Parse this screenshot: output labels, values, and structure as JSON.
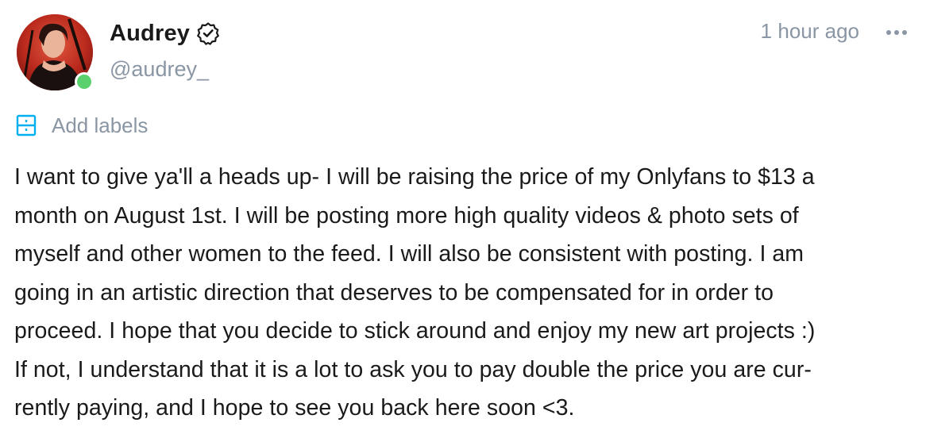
{
  "post": {
    "author": {
      "name": "Audrey",
      "handle": "@audrey_",
      "verified_icon": "verified-badge-icon",
      "online_status_color": "#5ad16c"
    },
    "timestamp": "1 hour ago",
    "more_icon": "more-horizontal-icon",
    "labels": {
      "icon": "label-icon",
      "text": "Add labels"
    },
    "body": "I want to give ya'll a heads up- I will be raising the price of my Onlyfans to $13 a\nmonth on August 1st. I will be posting more high quality videos & photo sets of\nmyself and other women to the feed. I will also be consistent with posting. I am\ngoing in an artistic direction that deserves to be compensated for in order to\nproceed. I hope that you decide to stick around and enjoy my new art projects :)\nIf not, I understand that it is a lot to ask you to pay double the price you are cur-\nrently paying, and I hope to see you back here soon <3."
  },
  "colors": {
    "accent": "#00aff0",
    "muted_text": "#8a96a3",
    "body_text": "#1a1a1a",
    "background": "#ffffff"
  }
}
